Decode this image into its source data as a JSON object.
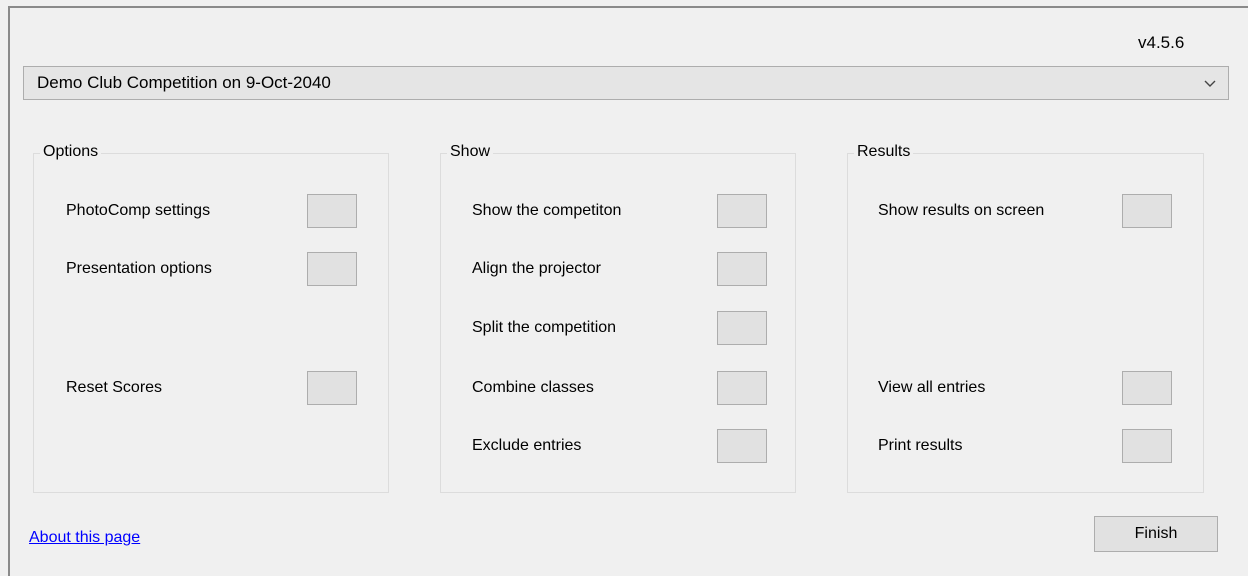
{
  "header": {
    "version": "v4.5.6"
  },
  "competition_select": {
    "selected": "Demo Club Competition on 9-Oct-2040"
  },
  "groups": {
    "options": {
      "title": "Options",
      "items": [
        {
          "label": "PhotoComp settings"
        },
        {
          "label": "Presentation options"
        },
        {
          "label": "Reset Scores"
        }
      ]
    },
    "show": {
      "title": "Show",
      "items": [
        {
          "label": "Show the competiton"
        },
        {
          "label": "Align the projector"
        },
        {
          "label": "Split the competition"
        },
        {
          "label": "Combine classes"
        },
        {
          "label": "Exclude entries"
        }
      ]
    },
    "results": {
      "title": "Results",
      "items": [
        {
          "label": "Show results on screen"
        },
        {
          "label": "View all entries"
        },
        {
          "label": "Print results"
        }
      ]
    }
  },
  "footer": {
    "about_link": "About this page",
    "finish_label": "Finish"
  },
  "icons": {
    "dropdown": "chevron-down-icon"
  }
}
